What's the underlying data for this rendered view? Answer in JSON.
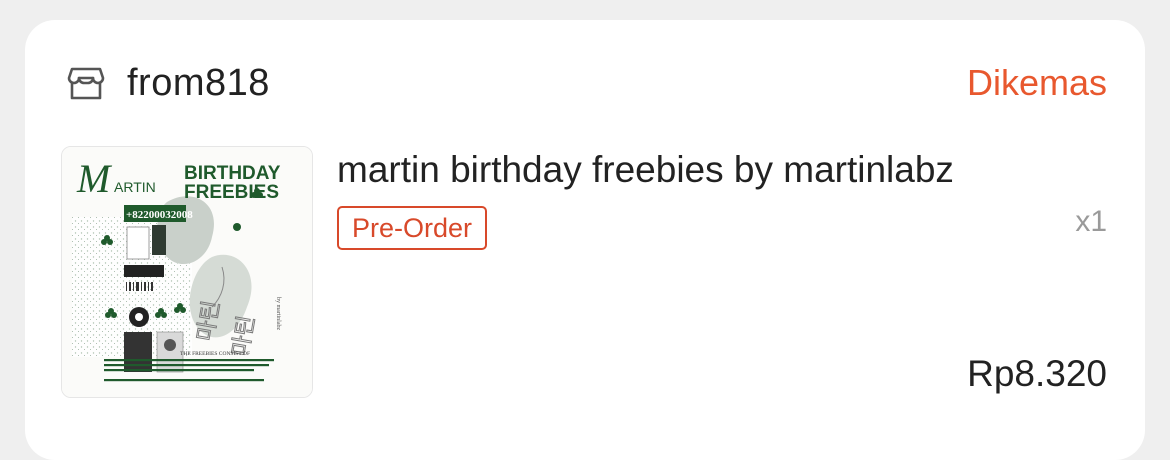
{
  "shop": {
    "icon": "store-icon",
    "name": "from818"
  },
  "order": {
    "status": "Dikemas",
    "status_color": "#e8582e"
  },
  "product": {
    "title": "martin birthday freebies by martinlabz",
    "badge": "Pre-Order",
    "quantity": "x1",
    "price": "Rp8.320",
    "thumbnail": {
      "heading_line1": "BIRTHDAY",
      "heading_line2": "FREEBIES",
      "script_name": "M",
      "script_rest": "ARTIN",
      "number_tag": "+82200032008",
      "caption_heading": "THE FREEBIES CONSIST OF",
      "side_text": "by martinlabz",
      "accent_color": "#1f5a2c"
    }
  }
}
